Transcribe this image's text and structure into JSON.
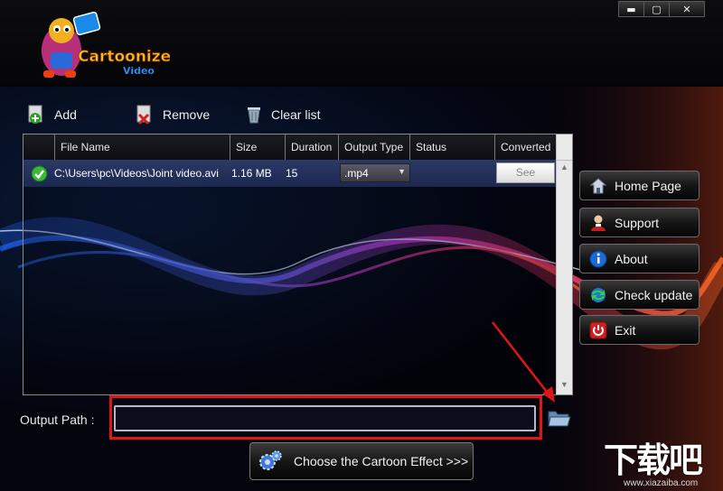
{
  "app": {
    "logo_text_1": "Cartoonize",
    "logo_text_2": "Video"
  },
  "window_controls": {
    "minimize": "▬",
    "maximize": "▢",
    "close": "✕"
  },
  "toolbar": {
    "add_label": "Add",
    "remove_label": "Remove",
    "clear_label": "Clear list"
  },
  "table": {
    "headers": [
      "File Name",
      "Size",
      "Duration",
      "Output Type",
      "Status",
      "Converted"
    ],
    "rows": [
      {
        "file_name": "C:\\Users\\pc\\Videos\\Joint video.avi",
        "size": "1.16 MB",
        "duration": "15",
        "output_type": ".mp4",
        "status": "",
        "converted_button": "See"
      }
    ]
  },
  "sidebar": {
    "home": "Home Page",
    "support": "Support",
    "about": "About",
    "check_update": "Check update",
    "exit": "Exit"
  },
  "output": {
    "label": "Output Path :",
    "value": ""
  },
  "choose_effect": {
    "label": "Choose the Cartoon Effect >>>"
  },
  "watermark": {
    "text": "下载吧",
    "url": "www.xiazaiba.com"
  },
  "colors": {
    "highlight_red": "#e01616",
    "row_selected": "#2a3a66"
  }
}
